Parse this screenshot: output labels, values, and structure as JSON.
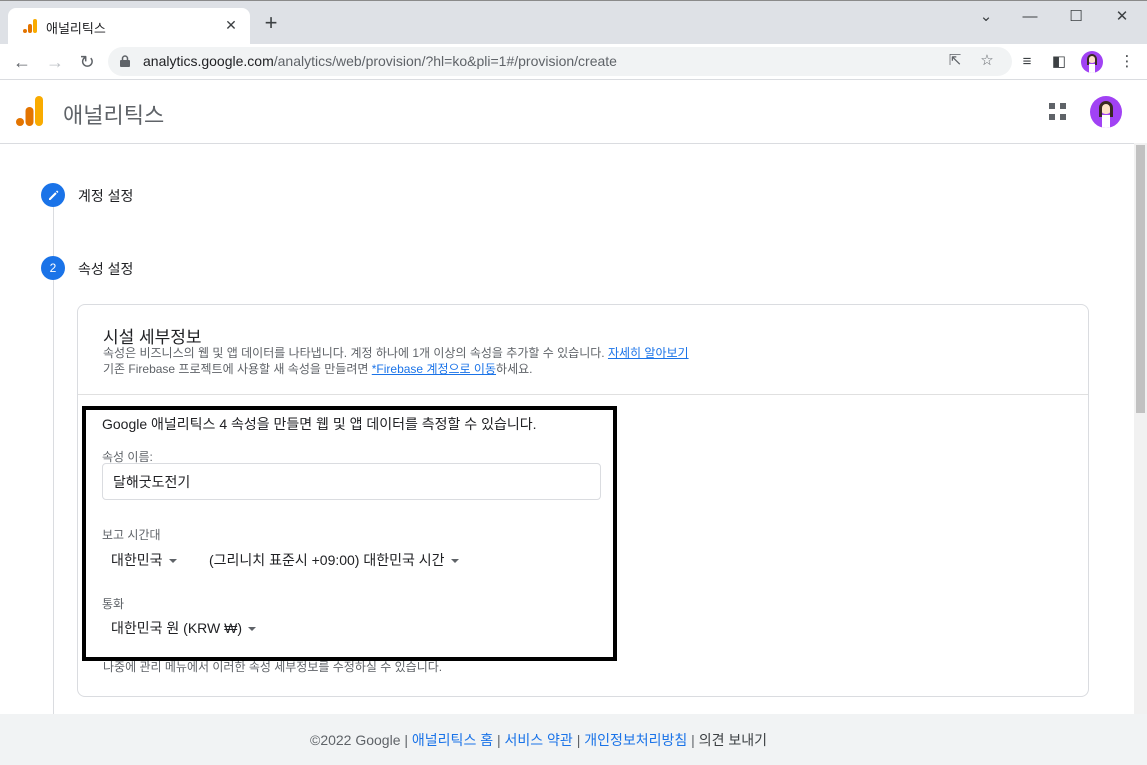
{
  "browser": {
    "tab_title": "애널리틱스",
    "url_host": "analytics.google.com",
    "url_path": "/analytics/web/provision/?hl=ko&pli=1#/provision/create"
  },
  "app": {
    "title": "애널리틱스"
  },
  "steps": [
    {
      "label": "계정 설정",
      "state": "done"
    },
    {
      "number": "2",
      "label": "속성 설정",
      "state": "active"
    }
  ],
  "card": {
    "title": "시설 세부정보",
    "desc_line1": "속성은 비즈니스의 웹 및 앱 데이터를 나타냅니다. 계정 하나에 1개 이상의 속성을 추가할 수 있습니다. ",
    "desc_link1": "자세히 알아보기",
    "desc_line2_prefix": "기존 Firebase 프로젝트에 사용할 새 속성을 만들려면 ",
    "desc_link2": "*Firebase 계정으로 이동",
    "desc_line2_suffix": "하세요.",
    "footnote": "나중에 관리 메뉴에서 이러한 속성 세부정보를 수정하실 수 있습니다."
  },
  "form": {
    "headline": "Google 애널리틱스 4 속성을 만들면 웹 및 앱 데이터를 측정할 수 있습니다.",
    "property_name_label": "속성 이름:",
    "property_name_value": "달해굿도전기",
    "timezone_label": "보고 시간대",
    "timezone_country": "대한민국",
    "timezone_value": "(그리니치 표준시 +09:00) 대한민국 시간",
    "currency_label": "통화",
    "currency_value": "대한민국 원 (KRW ₩)"
  },
  "footer": {
    "copyright": "©2022 Google",
    "sep": " | ",
    "link_home": "애널리틱스 홈",
    "link_terms": "서비스 약관",
    "link_privacy": "개인정보처리방침",
    "feedback": "의견 보내기"
  },
  "colors": {
    "accent": "#1a73e8",
    "logo_orange": "#f9ab00",
    "logo_dark_orange": "#e37400",
    "avatar": "#a142f4"
  }
}
